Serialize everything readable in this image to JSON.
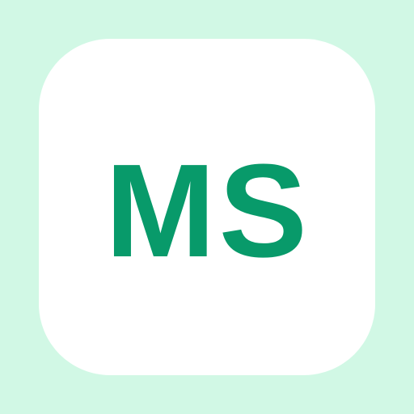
{
  "icon": {
    "monogram": "MS",
    "colors": {
      "background": "#d1f8e5",
      "tile": "#ffffff",
      "text": "#089a6a"
    }
  }
}
